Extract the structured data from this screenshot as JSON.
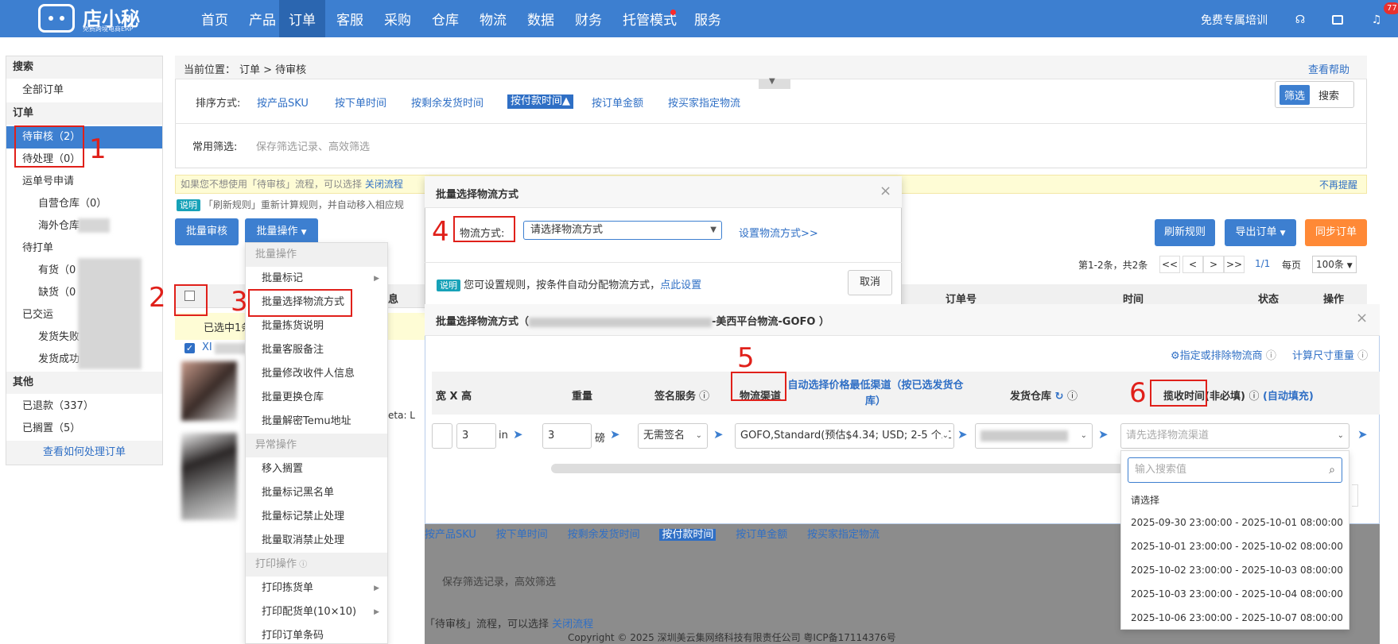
{
  "brand": {
    "name": "店小秘",
    "tagline": "免费跨境电商ERP"
  },
  "nav": {
    "items": [
      "首页",
      "产品",
      "订单",
      "客服",
      "采购",
      "仓库",
      "物流",
      "数据",
      "财务",
      "托管模式",
      "服务"
    ],
    "training": "免费专属培训",
    "badge_count": "77"
  },
  "sidebar": {
    "search": "搜索",
    "all_orders": "全部订单",
    "orders": "订单",
    "pending_review": "待审核（2）",
    "pending_process": "待处理（0）",
    "waybill": "运单号申请",
    "self_wh": "自营仓库（0）",
    "overseas_wh": "海外仓库",
    "pending_pick": "待打单",
    "in_stock": "有货（0",
    "out_stock": "缺货（0",
    "shipped": "已交运",
    "ship_fail": "发货失败",
    "ship_ok": "发货成功",
    "other": "其他",
    "refunded": "已退款（337）",
    "on_hold": "已搁置（5）",
    "howto": "查看如何处理订单"
  },
  "breadcrumb": {
    "label": "当前位置：",
    "path": "订单 > 待审核",
    "help": "查看帮助"
  },
  "sort": {
    "label": "排序方式:",
    "options": [
      "按产品SKU",
      "按下单时间",
      "按剩余发货时间",
      "按付款时间",
      "按订单金额",
      "按买家指定物流"
    ],
    "active_arrow": "▲"
  },
  "filter": {
    "label": "常用筛选:",
    "placeholder": "保存筛选记录、高效筛选",
    "mode_filter": "筛选",
    "mode_search": "搜索"
  },
  "notice": {
    "text": "如果您不想使用「待审核」流程，可以选择",
    "link": "关闭流程",
    "dismiss": "不再提醒"
  },
  "rule_notice": {
    "tag": "说明",
    "text": "「刷新规则」重新计算规则，并自动移入相应规"
  },
  "toolbar": {
    "batch_review": "批量审核",
    "batch_ops": "批量操作",
    "refresh_rules": "刷新规则",
    "export": "导出订单",
    "sync": "同步订单"
  },
  "pagination": {
    "summary": "第1-2条，共2条",
    "first": "<<",
    "prev": "<",
    "next": ">",
    "last": ">>",
    "page": "1/1",
    "per_page_label": "每页",
    "per_page": "100条"
  },
  "table": {
    "col_info": "息",
    "col_order_no": "订单号",
    "col_time": "时间",
    "col_status": "状态",
    "col_action": "操作",
    "selected": "已选中1条",
    "row_text": "eta: L",
    "row_prefix": "XI"
  },
  "batch_menu": {
    "section_batch": "批量操作",
    "items": [
      "批量标记",
      "批量选择物流方式",
      "批量拣货说明",
      "批量客服备注",
      "批量修改收件人信息",
      "批量更换仓库",
      "批量解密Temu地址"
    ],
    "section_exception": "异常操作",
    "exception_items": [
      "移入搁置",
      "批量标记黑名单",
      "批量标记禁止处理",
      "批量取消禁止处理"
    ],
    "section_print": "打印操作",
    "print_items": [
      "打印拣货单",
      "打印配货单(10×10)",
      "打印订单条码"
    ]
  },
  "modal1": {
    "title": "批量选择物流方式",
    "close": "×",
    "label": "物流方式:",
    "select_placeholder": "请选择物流方式",
    "settings_link": "设置物流方式>>",
    "tag": "说明",
    "desc": "您可设置规则，按条件自动分配物流方式，",
    "desc_link": "点此设置",
    "cancel": "取消"
  },
  "modal2": {
    "title_prefix": "批量选择物流方式（",
    "title_suffix": "-美西平台物流-GOFO ）",
    "close": "×",
    "link_carrier": "指定或排除物流商",
    "link_dim": "计算尺寸重量",
    "headers": {
      "dims": "宽 X 高",
      "weight": "重量",
      "sign": "签名服务",
      "channel": "物流渠道",
      "auto_channel": "自动选择价格最低渠道（按已选发货仓库）",
      "warehouse": "发货仓库",
      "pickup": "揽收时间",
      "pickup_note": "(非必填)",
      "auto_fill": "(自动填充)"
    },
    "row": {
      "height": "3",
      "unit_in": "in",
      "weight": "3",
      "unit_lb": "磅",
      "sign": "无需签名",
      "channel": "GOFO,Standard(预估$4.34; USD; 2-5 个工",
      "pickup_placeholder": "请先选择物流渠道"
    }
  },
  "date_dropdown": {
    "search_placeholder": "输入搜索值",
    "options": [
      "请选择",
      "2025-09-30 23:00:00 - 2025-10-01 08:00:00",
      "2025-10-01 23:00:00 - 2025-10-02 08:00:00",
      "2025-10-02 23:00:00 - 2025-10-03 08:00:00",
      "2025-10-03 23:00:00 - 2025-10-04 08:00:00",
      "2025-10-06 23:00:00 - 2025-10-07 08:00:00"
    ]
  },
  "background_sort": [
    "按产品SKU",
    "按下单时间",
    "按剩余发货时间",
    "按付款时间",
    "按订单金额",
    "按买家指定物流"
  ],
  "background_filter": "保存筛选记录，高效筛选",
  "background_notice": "「待审核」流程，可以选择",
  "background_notice_link": "关闭流程",
  "footer": "Copyright © 2025 深圳美云集网络科技有限责任公司 粤ICP备17114376号",
  "annotations": [
    "1",
    "2",
    "3",
    "4",
    "5",
    "6"
  ]
}
